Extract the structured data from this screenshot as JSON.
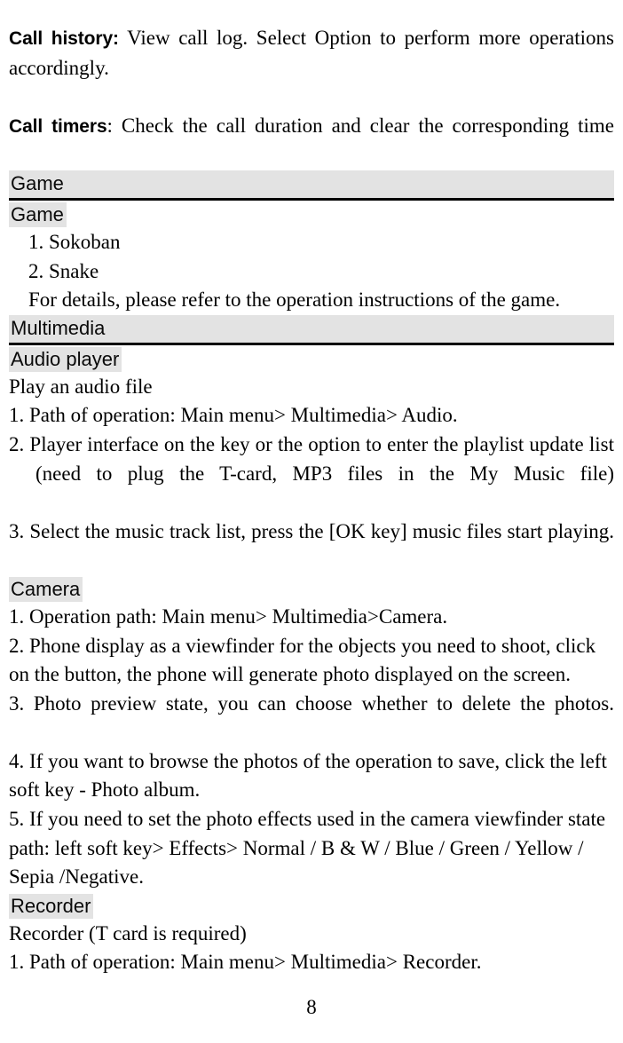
{
  "document": {
    "page_number": "8",
    "highlight_color": "#e3e3e3",
    "rule_color": "#000000"
  },
  "intro": {
    "call_history": {
      "lead": "Call history:",
      "text": " View call log. Select Option to perform more operations accordingly."
    },
    "call_timers": {
      "lead": "Call timers",
      "text": ": Check the call duration and clear the corresponding time"
    }
  },
  "sections": [
    {
      "bar_title": "Game",
      "sub_title": "Game",
      "items": [
        "1. Sokoban",
        "2. Snake",
        "For details, please refer to the operation instructions of the game."
      ]
    },
    {
      "bar_title": "Multimedia",
      "audio": {
        "sub_title": "Audio player",
        "intro": "Play an audio file",
        "steps": [
          "1. Path of operation: Main menu> Multimedia> Audio.",
          "2. Player interface on the key or the option to enter the playlist update list (need to plug the T-card, MP3 files in the My Music file)",
          "3. Select the music track list, press the [OK key] music files start playing."
        ]
      },
      "camera": {
        "sub_title": "Camera",
        "steps": [
          "1. Operation path: Main menu> Multimedia>Camera.",
          "2. Phone display as a viewfinder for the objects you need to shoot, click on the button, the phone will generate photo displayed on the screen.",
          "3. Photo preview state, you can choose whether to delete the photos.",
          "4. If you want to browse the photos of the operation to save, click the left soft key - Photo album.",
          "5. If you need to set the photo effects used in the camera viewfinder state path: left soft key> Effects> Normal / B & W / Blue / Green / Yellow / Sepia /Negative."
        ]
      },
      "recorder": {
        "sub_title": "Recorder",
        "intro": "Recorder (T card is required)",
        "steps": [
          "1. Path of operation: Main menu> Multimedia> Recorder."
        ]
      }
    }
  ]
}
